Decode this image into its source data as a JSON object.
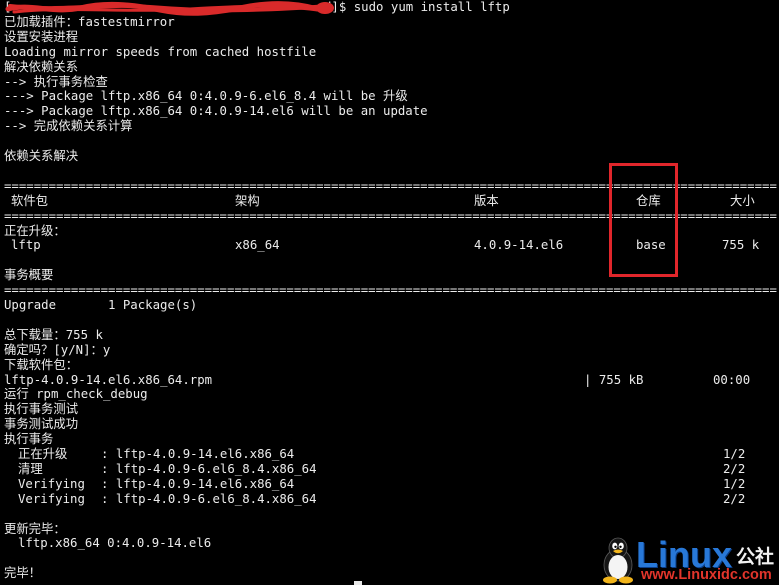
{
  "colors": {
    "background": "#000000",
    "text": "#ececec",
    "highlight_box": "#e0262b",
    "redaction": "#d92a2a",
    "watermark_brand": "#2878d8",
    "watermark_url": "#e2352b"
  },
  "prompt": {
    "open_bracket": "[",
    "command": "d]$ sudo yum install lftp"
  },
  "log": {
    "plugins": "已加载插件：fastestmirror",
    "setup": "设置安装进程",
    "loading_mirrors": "Loading mirror speeds from cached hostfile",
    "resolving": "解决依赖关系",
    "txn_check": "--> 执行事务检查",
    "pkg_old": "---> Package lftp.x86_64 0:4.0.9-6.el6_8.4 will be 升级",
    "pkg_new": "---> Package lftp.x86_64 0:4.0.9-14.el6 will be an update",
    "deps_done": "--> 完成依赖关系计算",
    "resolved": "依赖关系解决"
  },
  "separator": "========================================================================================================",
  "package_table": {
    "columns": [
      "软件包",
      "架构",
      "版本",
      "仓库",
      "大小"
    ],
    "section_label": "正在升级：",
    "rows": [
      {
        "package": "lftp",
        "arch": "x86_64",
        "version": "4.0.9-14.el6",
        "repo": "base",
        "size": "755 k"
      }
    ]
  },
  "summary": {
    "title": "事务概要",
    "action": "Upgrade",
    "count": "1 Package(s)",
    "total_download": "总下载量：755 k",
    "confirm": "确定吗？[y/N]：y",
    "downloading": "下载软件包："
  },
  "download": {
    "file": "lftp-4.0.9-14.el6.x86_64.rpm",
    "size": "| 755 kB",
    "time": "00:00"
  },
  "transaction": {
    "check_debug": "运行 rpm_check_debug",
    "testing": "执行事务测试",
    "test_ok": "事务测试成功",
    "running": "执行事务",
    "steps": [
      {
        "action": "正在升级",
        "target": ": lftp-4.0.9-14.el6.x86_64",
        "progress": "1/2"
      },
      {
        "action": "清理",
        "target": ": lftp-4.0.9-6.el6_8.4.x86_64",
        "progress": "2/2"
      },
      {
        "action": "Verifying",
        "target": ": lftp-4.0.9-14.el6.x86_64",
        "progress": "1/2"
      },
      {
        "action": "Verifying",
        "target": ": lftp-4.0.9-6.el6_8.4.x86_64",
        "progress": "2/2"
      }
    ]
  },
  "result": {
    "updated_label": "更新完毕：",
    "updated_package": "lftp.x86_64 0:4.0.9-14.el6",
    "done": "完毕！"
  },
  "watermark": {
    "logo_icon": "tux-penguin-icon",
    "brand": "Linux",
    "brand_suffix": "公社",
    "url": "www.Linuxidc.com"
  }
}
